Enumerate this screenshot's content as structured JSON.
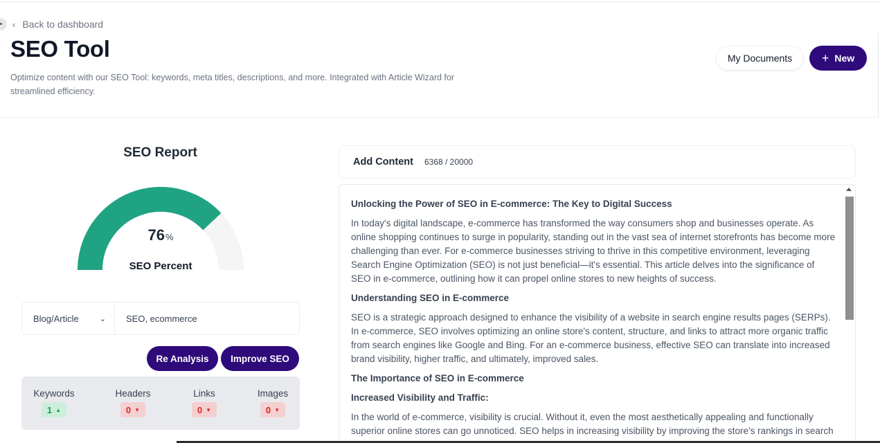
{
  "nav": {
    "back_label": "Back to dashboard"
  },
  "page": {
    "title": "SEO Tool",
    "subtitle": "Optimize content with our SEO Tool: keywords, meta titles, descriptions, and more. Integrated with Article Wizard for streamlined efficiency."
  },
  "actions": {
    "my_documents": "My Documents",
    "new": "New"
  },
  "report": {
    "title": "SEO Report",
    "percent_value": "76",
    "percent_symbol": "%",
    "percent_fraction": 0.76,
    "percent_label": "SEO Percent",
    "gauge_color": "#1fa383",
    "gauge_track_color": "#f5f5f5"
  },
  "form": {
    "content_type": "Blog/Article",
    "keywords_value": "SEO, ecommerce"
  },
  "buttons": {
    "reanalysis": "Re Analysis",
    "improve": "Improve SEO",
    "accent": "#2e0a7a"
  },
  "stats": [
    {
      "label": "Keywords",
      "value": "1",
      "status": "good"
    },
    {
      "label": "Headers",
      "value": "0",
      "status": "bad"
    },
    {
      "label": "Links",
      "value": "0",
      "status": "bad"
    },
    {
      "label": "Images",
      "value": "0",
      "status": "bad"
    }
  ],
  "content": {
    "title": "Add Content",
    "char_count": "6368 / 20000",
    "blocks": [
      {
        "type": "h",
        "text": "Unlocking the Power of SEO in E-commerce: The Key to Digital Success"
      },
      {
        "type": "p",
        "text": "In today's digital landscape, e-commerce has transformed the way consumers shop and businesses operate. As online shopping continues to surge in popularity, standing out in the vast sea of internet storefronts has become more challenging than ever. For e-commerce businesses striving to thrive in this competitive environment, leveraging Search Engine Optimization (SEO) is not just beneficial—it's essential. This article delves into the significance of SEO in e-commerce, outlining how it can propel online stores to new heights of success."
      },
      {
        "type": "h",
        "text": "Understanding SEO in E-commerce"
      },
      {
        "type": "p",
        "text": "SEO is a strategic approach designed to enhance the visibility of a website in search engine results pages (SERPs). In e-commerce, SEO involves optimizing an online store's content, structure, and links to attract more organic traffic from search engines like Google and Bing. For an e-commerce business, effective SEO can translate into increased brand visibility, higher traffic, and ultimately, improved sales."
      },
      {
        "type": "h",
        "text": "The Importance of SEO in E-commerce"
      },
      {
        "type": "h",
        "text": "Increased Visibility and Traffic:"
      },
      {
        "type": "p",
        "text": "In the world of e-commerce, visibility is crucial. Without it, even the most aesthetically appealing and functionally superior online stores can go unnoticed. SEO helps in increasing visibility by improving the store's rankings in search engine results. When your e-commerce site appears on the first page of search results, it's more likely to"
      }
    ]
  }
}
